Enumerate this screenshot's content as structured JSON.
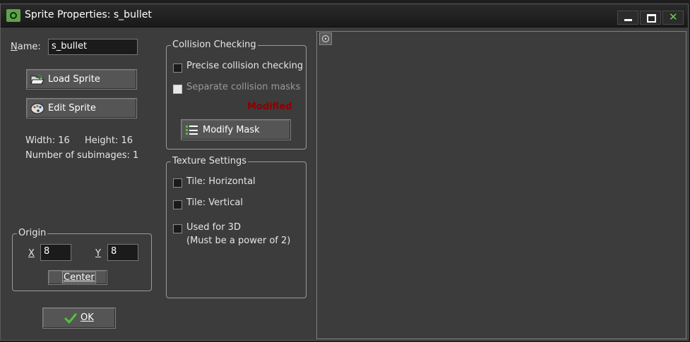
{
  "window": {
    "title": "Sprite Properties: s_bullet"
  },
  "name_field": {
    "label": "Name:",
    "value": "s_bullet"
  },
  "buttons": {
    "load_sprite": "Load Sprite",
    "edit_sprite": "Edit Sprite",
    "modify_mask": "Modify Mask",
    "center": "Center",
    "ok": "OK"
  },
  "sprite_info": {
    "width": "Width: 16",
    "height": "Height: 16",
    "subimages": "Number of subimages: 1"
  },
  "origin": {
    "title": "Origin",
    "x_label": "X",
    "x_value": "8",
    "y_label": "Y",
    "y_value": "8"
  },
  "collision": {
    "title": "Collision Checking",
    "precise": "Precise collision checking",
    "precise_checked": false,
    "separate": "Separate collision masks",
    "separate_enabled": false,
    "status": "Modified",
    "status_color": "#8b0000"
  },
  "texture": {
    "title": "Texture Settings",
    "tile_h": "Tile: Horizontal",
    "tile_v": "Tile: Vertical",
    "used_3d_line1": "Used for 3D",
    "used_3d_line2": "(Must be a power of 2)"
  },
  "icons": {
    "app": "gamemaker-icon",
    "load": "folder-open-icon",
    "edit": "palette-icon",
    "mask": "list-icon",
    "ok": "checkmark-icon",
    "origin": "origin-crosshair-icon"
  },
  "colors": {
    "accent_green": "#6bd24a",
    "background": "#3c3c3c"
  }
}
